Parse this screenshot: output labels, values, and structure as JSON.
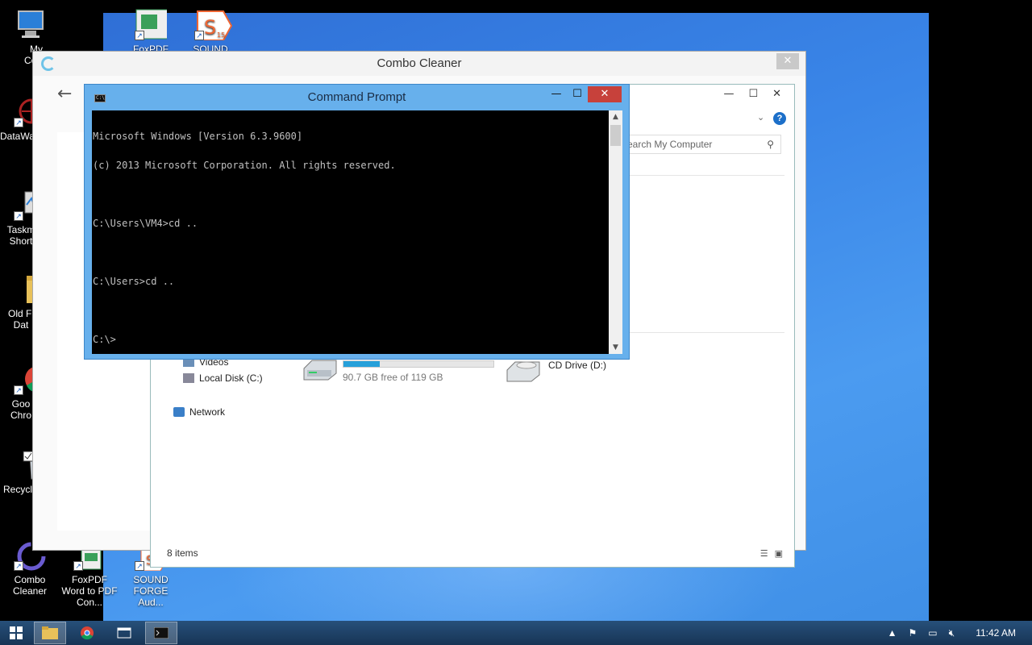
{
  "desktop": {
    "icons": [
      {
        "label": "My Comp",
        "icon": "computer-icon"
      },
      {
        "label": "DataWa",
        "icon": "datawatch-icon"
      },
      {
        "label": "Taskm Short",
        "icon": "task-manager-icon"
      },
      {
        "label": "Old Fi Dat",
        "icon": "folder-icon"
      },
      {
        "label": "Goo Chro",
        "icon": "chrome-icon"
      },
      {
        "label": "Recycl",
        "icon": "recycle-bin-icon"
      },
      {
        "label": "Combo Cleaner",
        "icon": "combo-cleaner-icon"
      },
      {
        "label": "FoxPDF Word to PDF Con...",
        "icon": "foxpdf-icon"
      },
      {
        "label": "SOUND FORGE Aud...",
        "icon": "sound-forge-icon"
      },
      {
        "label": "FoxPDF",
        "icon": "foxpdf-icon"
      },
      {
        "label": "SOUND",
        "icon": "sound-forge-icon"
      }
    ]
  },
  "combo_cleaner": {
    "title": "Combo Cleaner",
    "close": "✕",
    "back": "←"
  },
  "explorer": {
    "search_placeholder": "earch My Computer",
    "nav": [
      {
        "label": "Videos"
      },
      {
        "label": "Local Disk (C:)"
      },
      {
        "label": "Network"
      }
    ],
    "drives": [
      {
        "label": "",
        "free": "90.7 GB free of 119 GB",
        "used_fraction": 0.24
      },
      {
        "label": "CD Drive (D:)"
      }
    ],
    "status": "8 items",
    "controls": {
      "min": "—",
      "max": "☐",
      "close": "✕"
    }
  },
  "cmd": {
    "title": "Command Prompt",
    "controls": {
      "min": "—",
      "max": "☐",
      "close": "✕"
    },
    "lines": [
      "Microsoft Windows [Version 6.3.9600]",
      "(c) 2013 Microsoft Corporation. All rights reserved.",
      "",
      "C:\\Users\\VM4>cd ..",
      "",
      "C:\\Users>cd ..",
      "",
      "C:\\>"
    ]
  },
  "taskbar": {
    "clock": "11:42 AM"
  }
}
